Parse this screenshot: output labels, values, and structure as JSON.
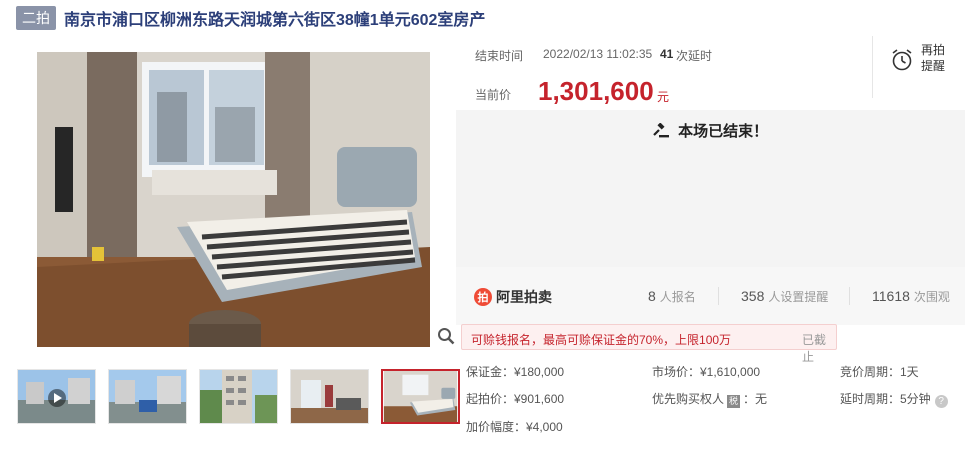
{
  "listing": {
    "round_badge": "二拍",
    "title": "南京市浦口区柳洲东路天润城第六街区38幢1单元602室房产"
  },
  "auction": {
    "end_label": "结束时间",
    "end_time": "2022/02/13 11:02:35",
    "delay_count": "41",
    "delay_label": "次延时",
    "current_price_label": "当前价",
    "current_price": "1,301,600",
    "price_unit": "元",
    "reminder_line1": "再拍",
    "reminder_line2": "提醒",
    "ended_text": "本场已结束！"
  },
  "platform": {
    "logo_mark": "拍",
    "logo_text": "阿里拍卖"
  },
  "stats": {
    "signup_count": "8",
    "signup_label": "人报名",
    "reminder_count": "358",
    "reminder_label": "人设置提醒",
    "view_count": "11618",
    "view_label": "次围观"
  },
  "deposit_note": {
    "text": "可赊钱报名，最高可赊保证金的70%，上限100万",
    "status": "已截止"
  },
  "details": {
    "deposit": "保证金：¥180,000",
    "market_price": "市场价：¥1,610,000",
    "cycle": "竞价周期：1天",
    "start_price": "起拍价：¥901,600",
    "priority_prefix": "优先购买权人",
    "priority_mark": "税",
    "priority_value": "：无",
    "delay_cycle": "延时周期：5分钟",
    "help_icon": "?",
    "increment": "加价幅度：¥4,000"
  },
  "colors": {
    "accent": "#c5232c",
    "title": "#2c3f79",
    "badge": "#8a93a8"
  }
}
